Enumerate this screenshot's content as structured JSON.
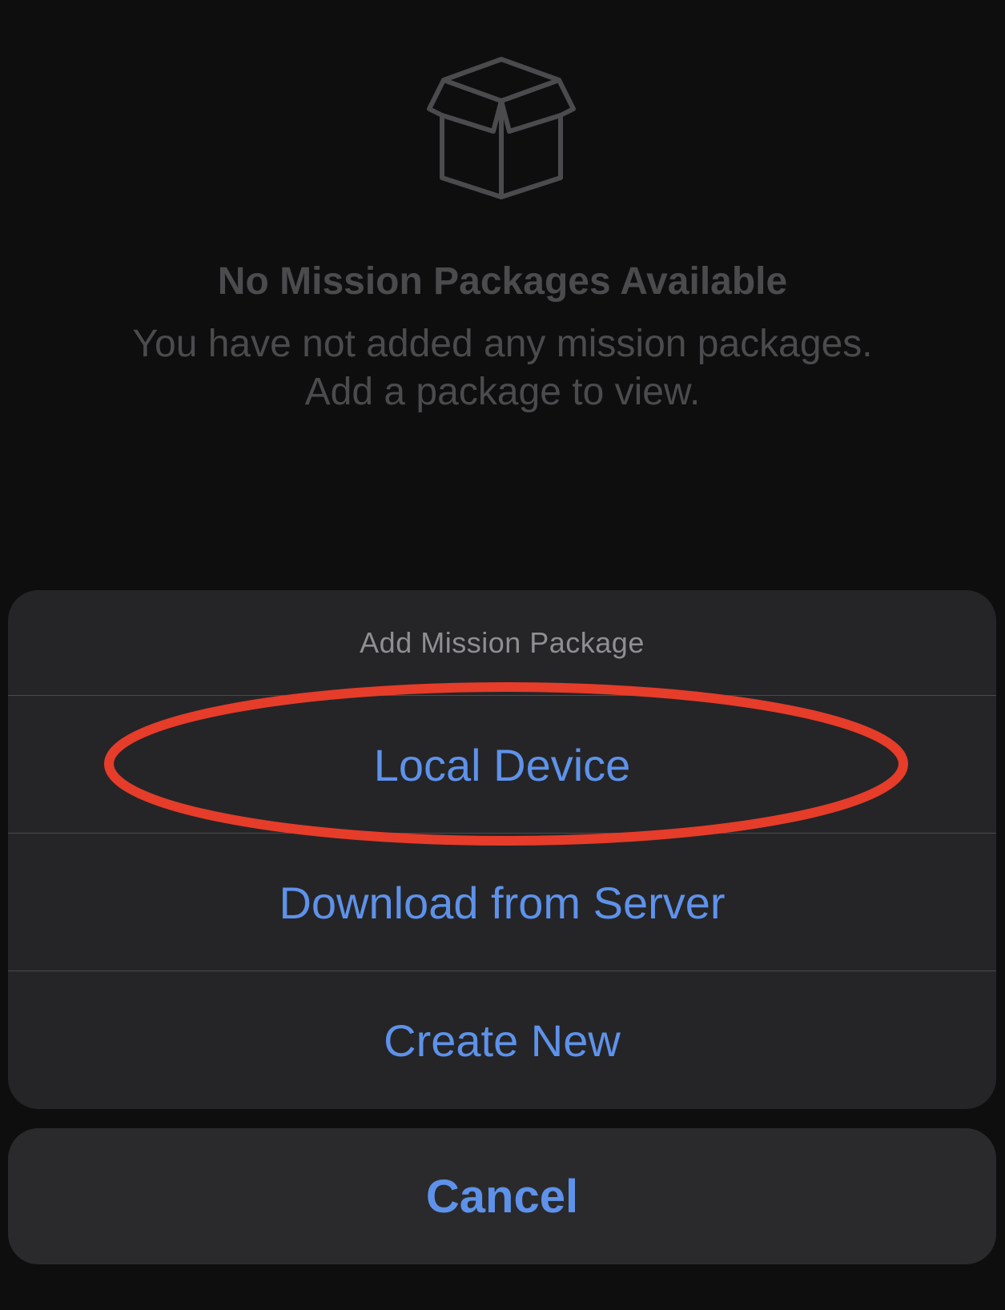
{
  "empty_state": {
    "icon": "open-box-icon",
    "title": "No Mission Packages Available",
    "message_line1": "You have not added any mission packages.",
    "message_line2": "Add a package to view."
  },
  "action_sheet": {
    "title": "Add Mission Package",
    "options": [
      {
        "label": "Local Device",
        "highlighted": true
      },
      {
        "label": "Download from Server",
        "highlighted": false
      },
      {
        "label": "Create New",
        "highlighted": false
      }
    ],
    "cancel_label": "Cancel"
  },
  "colors": {
    "background": "#0e0e0f",
    "sheet": "#252527",
    "action_blue": "#5e92ea",
    "muted_text": "#4b4b4d",
    "annotation_red": "#e63c2a"
  }
}
